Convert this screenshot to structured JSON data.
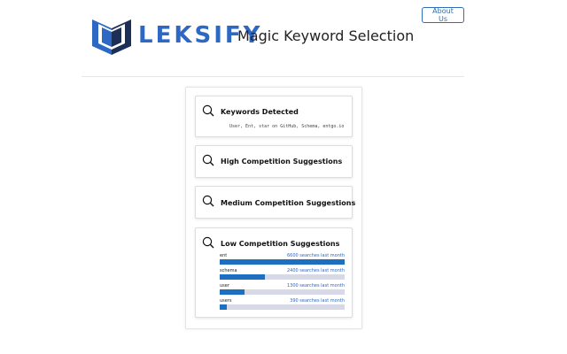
{
  "header": {
    "brand": "LEKSIFY",
    "tagline": "Magic Keyword Selection",
    "about_label": "About Us"
  },
  "icons": {
    "card": "search-icon",
    "logo": "book-logo-icon"
  },
  "colors": {
    "brand": "#2d68c4",
    "bar_fill": "#1f6fc1",
    "bar_track": "#d7dae6"
  },
  "cards": {
    "detected": {
      "title": "Keywords Detected",
      "subtitle": "User, Ent, star on GitHub, Schema, entgo.io"
    },
    "high": {
      "title": "High Competition Suggestions"
    },
    "medium": {
      "title": "Medium Competition Suggestions"
    },
    "low": {
      "title": "Low Competition Suggestions",
      "keywords": [
        {
          "name": "ent",
          "count": "6600 searches last month",
          "level": 1.0
        },
        {
          "name": "schema",
          "count": "2400 searches last month",
          "level": 0.364
        },
        {
          "name": "user",
          "count": "1300 searches last month",
          "level": 0.197
        },
        {
          "name": "users",
          "count": "390 searches last month",
          "level": 0.059
        }
      ]
    }
  }
}
